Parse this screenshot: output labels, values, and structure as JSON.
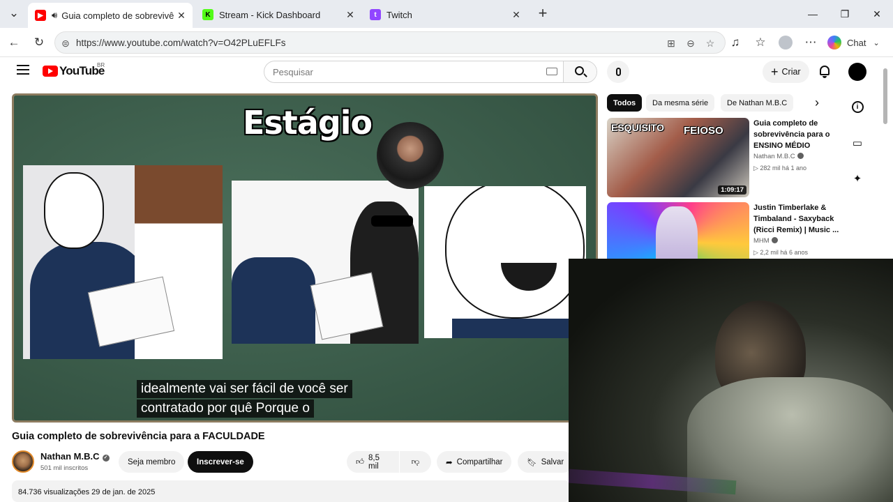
{
  "browser": {
    "tabs": [
      {
        "label": "Guia completo de sobrevivência",
        "favicon": "youtube-icon",
        "active": true
      },
      {
        "label": "Stream - Kick Dashboard",
        "favicon": "kick-icon",
        "active": false
      },
      {
        "label": "Twitch",
        "favicon": "twitch-icon",
        "active": false
      }
    ],
    "url": "https://www.youtube.com/watch?v=O42PLuEFLFs",
    "chat_label": "Chat"
  },
  "youtube": {
    "logo_text": "YouTube",
    "country_code": "BR",
    "search_placeholder": "Pesquisar",
    "create_label": "Criar"
  },
  "video": {
    "overlay_title": "Estágio",
    "subtitles": [
      "idealmente vai ser fácil de você ser",
      "contratado por quê Porque o"
    ],
    "title": "Guia completo de sobrevivência para a FACULDADE",
    "channel": "Nathan M.B.C",
    "subscribers": "501 mil inscritos",
    "join_label": "Seja membro",
    "subscribe_label": "Inscrever-se",
    "likes": "8,5 mil",
    "share_label": "Compartilhar",
    "save_label": "Salvar",
    "views_date": "84.736 visualizações  29 de jan. de 2025"
  },
  "sidebar": {
    "chips": [
      "Todos",
      "Da mesma série",
      "De Nathan M.B.C"
    ],
    "recommendations": [
      {
        "title": "Guia completo de sobrevivência para o ENSINO MÉDIO",
        "channel": "Nathan M.B.C",
        "meta": "282 mil  há 1 ano",
        "duration": "1:09:17",
        "thumb_text": [
          "ESQUISITO",
          "FEIOSO"
        ]
      },
      {
        "title": "Justin Timberlake & Timbaland - Saxyback (Ricci Remix) | Music ...",
        "channel": "MHM",
        "meta": "2,2 mil  há 6 anos",
        "duration": ""
      }
    ]
  },
  "colors": {
    "youtube_red": "#ff0000",
    "kick_green": "#53fc18",
    "twitch_purple": "#9146ff"
  }
}
